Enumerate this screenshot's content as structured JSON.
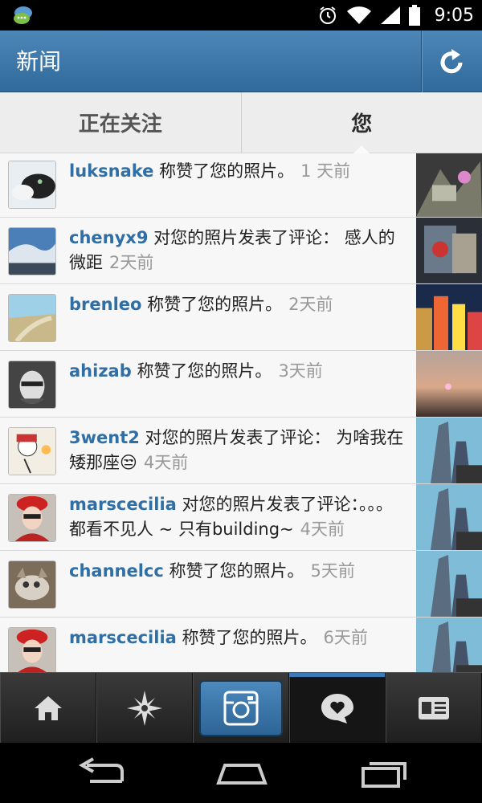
{
  "status_bar": {
    "time": "9:05"
  },
  "header": {
    "title": "新闻"
  },
  "tabs": [
    {
      "label": "正在关注",
      "active": false
    },
    {
      "label": "您",
      "active": true
    }
  ],
  "notifications": [
    {
      "user": "luksnake",
      "text": "称赞了您的照片。",
      "time": "1 天前"
    },
    {
      "user": "chenyx9",
      "text": "对您的照片发表了评论： 感人的微距",
      "time": "2天前"
    },
    {
      "user": "brenleo",
      "text": "称赞了您的照片。",
      "time": "2天前"
    },
    {
      "user": "ahizab",
      "text": "称赞了您的照片。",
      "time": "3天前"
    },
    {
      "user": "3went2",
      "text": "对您的照片发表了评论： 为啥我在矮那座😒",
      "time": "4天前"
    },
    {
      "user": "marscecilia",
      "text": "对您的照片发表了评论：。。。都看不见人 ~ 只有building~",
      "time": "4天前"
    },
    {
      "user": "channelcc",
      "text": "称赞了您的照片。",
      "time": "5天前"
    },
    {
      "user": "marscecilia",
      "text": "称赞了您的照片。",
      "time": "6天前"
    }
  ],
  "bottom_nav": [
    {
      "name": "home-icon"
    },
    {
      "name": "explore-icon"
    },
    {
      "name": "camera-icon"
    },
    {
      "name": "news-icon",
      "active": true
    },
    {
      "name": "profile-icon"
    }
  ],
  "colors": {
    "header": "#3f79aa",
    "username": "#2f6fa5",
    "timestamp": "#999999",
    "nav_active": "#3b7cb8"
  }
}
